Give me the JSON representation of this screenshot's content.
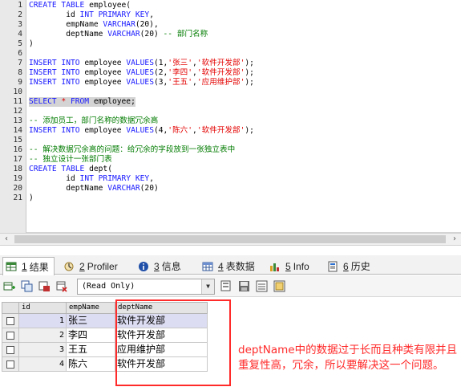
{
  "editor": {
    "line_numbers": [
      "1",
      "2",
      "3",
      "4",
      "5",
      "6",
      "7",
      "8",
      "9",
      "10",
      "11",
      "12",
      "13",
      "14",
      "15",
      "16",
      "17",
      "18",
      "19",
      "20",
      "21"
    ],
    "code": {
      "l1_kw": "CREATE TABLE",
      "l1_rest": " employee(",
      "l2_indent": "        id ",
      "l2_kw": "INT PRIMARY KEY",
      "l2_punct": ",",
      "l3_indent": "        empName ",
      "l3_kw": "VARCHAR",
      "l3_args": "(20),",
      "l4_indent": "        deptName ",
      "l4_kw": "VARCHAR",
      "l4_args": "(20) ",
      "l4_comment": "-- 部门名称",
      "l5": ")",
      "insert_kw": "INSERT INTO",
      "table_name": " employee ",
      "values_kw": "VALUES",
      "l7_vals": "(1,",
      "l7_str1": "'张三'",
      "l7_comma": ",",
      "l7_str2": "'软件开发部'",
      "l7_end": ");",
      "l8_vals": "(2,",
      "l8_str1": "'李四'",
      "l8_comma": ",",
      "l8_str2": "'软件开发部'",
      "l8_end": ");",
      "l9_vals": "(3,",
      "l9_str1": "'王五'",
      "l9_comma": ",",
      "l9_str2": "'应用维护部'",
      "l9_end": ");",
      "l11_select": "SELECT",
      "l11_star": " * ",
      "l11_from": "FROM",
      "l11_rest": " employee;",
      "l13_comment": "-- 添加员工，部门名称的数据冗余高",
      "l14_vals": "(4,",
      "l14_str1": "'陈六'",
      "l14_comma": ",",
      "l14_str2": "'软件开发部'",
      "l14_end": ");",
      "l16_comment": "-- 解决数据冗余高的问题：给冗余的字段放到一张独立表中",
      "l17_comment": "-- 独立设计一张部门表",
      "l18_kw": "CREATE TABLE",
      "l18_rest": " dept(",
      "l19_indent": "        id ",
      "l19_kw": "INT PRIMARY KEY",
      "l19_punct": ",",
      "l20_indent": "        deptName ",
      "l20_kw": "VARCHAR",
      "l20_args": "(20)",
      "l21": ")"
    }
  },
  "scrollbar": {
    "left_arrow": "‹",
    "right_arrow": "›"
  },
  "tabs": [
    {
      "num": "1",
      "label": "结果",
      "icon": "results-grid-icon"
    },
    {
      "num": "2",
      "label": "Profiler",
      "icon": "profiler-icon"
    },
    {
      "num": "3",
      "label": "信息",
      "icon": "info-icon"
    },
    {
      "num": "4",
      "label": "表数据",
      "icon": "table-data-icon"
    },
    {
      "num": "5",
      "label": "Info",
      "icon": "table-info-icon"
    },
    {
      "num": "6",
      "label": "历史",
      "icon": "history-icon"
    }
  ],
  "result_toolbar": {
    "mode_select": "(Read Only)",
    "dropdown_arrow": "▼"
  },
  "grid": {
    "columns": [
      "id",
      "empName",
      "deptName"
    ],
    "rows": [
      {
        "id": "1",
        "empName": "张三",
        "deptName": "软件开发部"
      },
      {
        "id": "2",
        "empName": "李四",
        "deptName": "软件开发部"
      },
      {
        "id": "3",
        "empName": "王五",
        "deptName": "应用维护部"
      },
      {
        "id": "4",
        "empName": "陈六",
        "deptName": "软件开发部"
      }
    ]
  },
  "annotation": "deptName中的数据过于长而且种类有限并且重复性高，冗余，所以要解决这一个问题。",
  "colors": {
    "keyword": "#1818ff",
    "string": "#e40000",
    "comment": "#007b00",
    "annotation": "#ff2a2a"
  }
}
